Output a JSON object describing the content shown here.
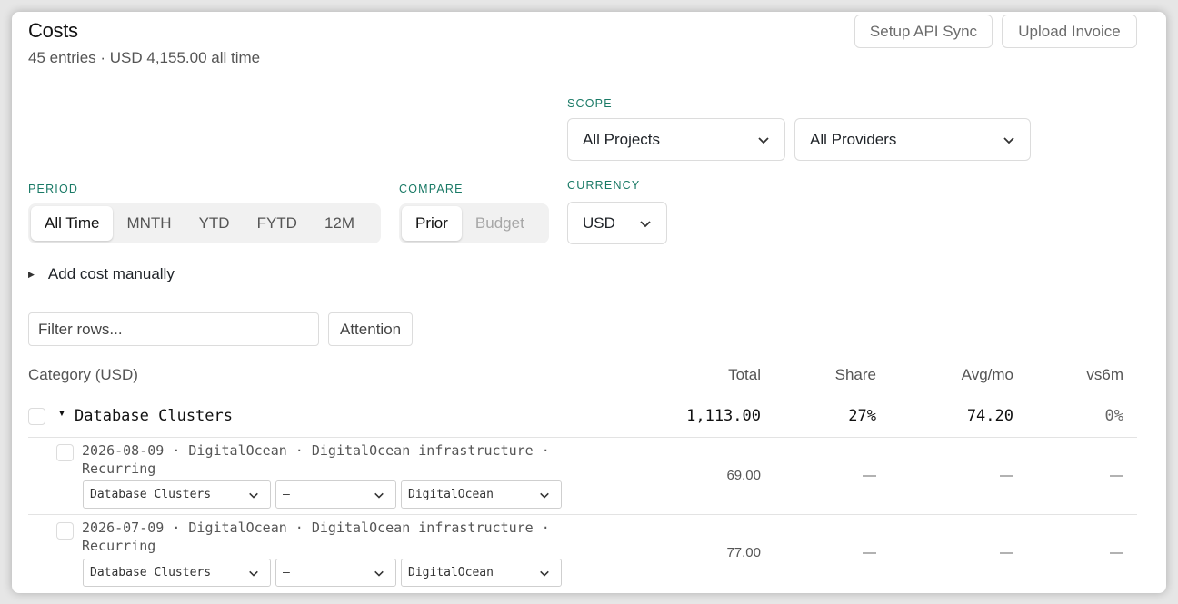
{
  "header": {
    "title": "Costs",
    "subtitle": "45 entries · USD 4,155.00 all time",
    "setup_api_sync": "Setup API Sync",
    "upload_invoice": "Upload Invoice"
  },
  "scope": {
    "label": "SCOPE",
    "projects": "All Projects",
    "providers": "All Providers"
  },
  "period": {
    "label": "PERIOD",
    "options": [
      "All Time",
      "MNTH",
      "YTD",
      "FYTD",
      "12M"
    ],
    "selected": "All Time"
  },
  "compare": {
    "label": "COMPARE",
    "options": [
      "Prior",
      "Budget"
    ],
    "selected": "Prior"
  },
  "currency": {
    "label": "CURRENCY",
    "value": "USD"
  },
  "add_cost": "Add cost manually",
  "filter": {
    "placeholder": "Filter rows...",
    "attention": "Attention"
  },
  "table": {
    "headers": {
      "category": "Category (USD)",
      "total": "Total",
      "share": "Share",
      "avg": "Avg/mo",
      "vs6m": "vs6m"
    },
    "group": {
      "name": "Database Clusters",
      "total": "1,113.00",
      "share": "27%",
      "avg": "74.20",
      "vs6m": "0%"
    },
    "entries": [
      {
        "line1": "2026-08-09 · DigitalOcean · DigitalOcean infrastructure ·",
        "line2": "Recurring",
        "category": "Database Clusters",
        "project": "—",
        "provider": "DigitalOcean",
        "total": "69.00",
        "share": "—",
        "avg": "—",
        "vs6m": "—"
      },
      {
        "line1": "2026-07-09 · DigitalOcean · DigitalOcean infrastructure ·",
        "line2": "Recurring",
        "category": "Database Clusters",
        "project": "—",
        "provider": "DigitalOcean",
        "total": "77.00",
        "share": "—",
        "avg": "—",
        "vs6m": "—"
      }
    ]
  }
}
